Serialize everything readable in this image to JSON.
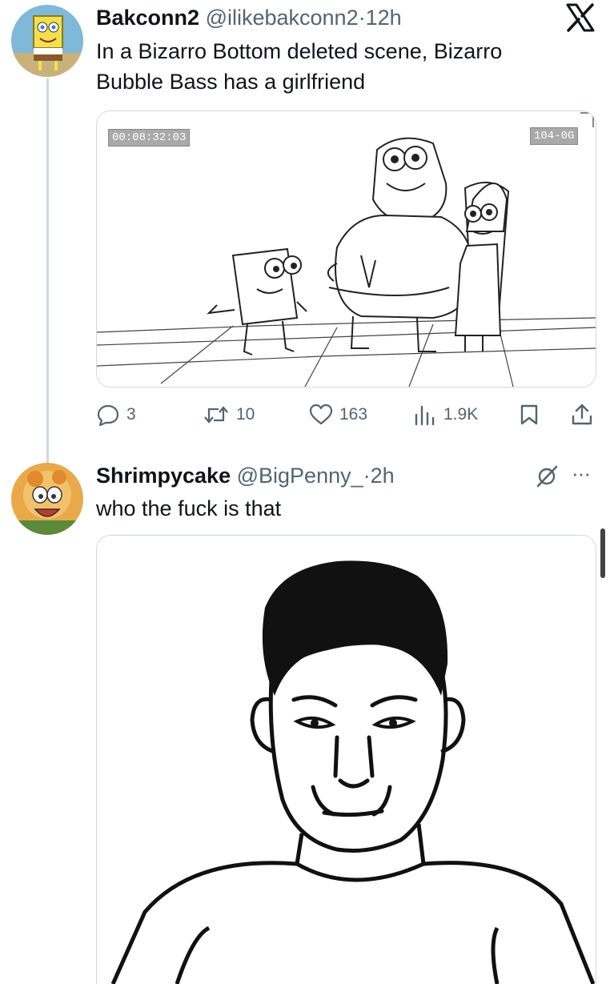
{
  "tweet1": {
    "display_name": "Bakconn2",
    "handle": "@ilikebakconn2",
    "separator": "·",
    "time": "12h",
    "text_line1": "In a Bizarro Bottom deleted scene, Bizarro",
    "text_line2": "Bubble Bass has a girlfriend",
    "media": {
      "timecode": "00:08:32:03",
      "scene_code": "104-0G"
    },
    "actions": {
      "replies": "3",
      "retweets": "10",
      "likes": "163",
      "views": "1.9K"
    }
  },
  "tweet2": {
    "display_name": "Shrimpycake",
    "handle": "@BigPenny_",
    "separator": "·",
    "time": "2h",
    "text": "who the fuck is that",
    "more": "···"
  },
  "header": {
    "logo_text": "X"
  },
  "colors": {
    "text": "#0f1419",
    "muted": "#536471",
    "border": "#cfd9de"
  },
  "icons": [
    "spongebob-avatar",
    "x-logo-icon",
    "reply-icon",
    "retweet-icon",
    "like-icon",
    "views-icon",
    "bookmark-icon",
    "share-icon",
    "grok-icon",
    "more-icon"
  ]
}
